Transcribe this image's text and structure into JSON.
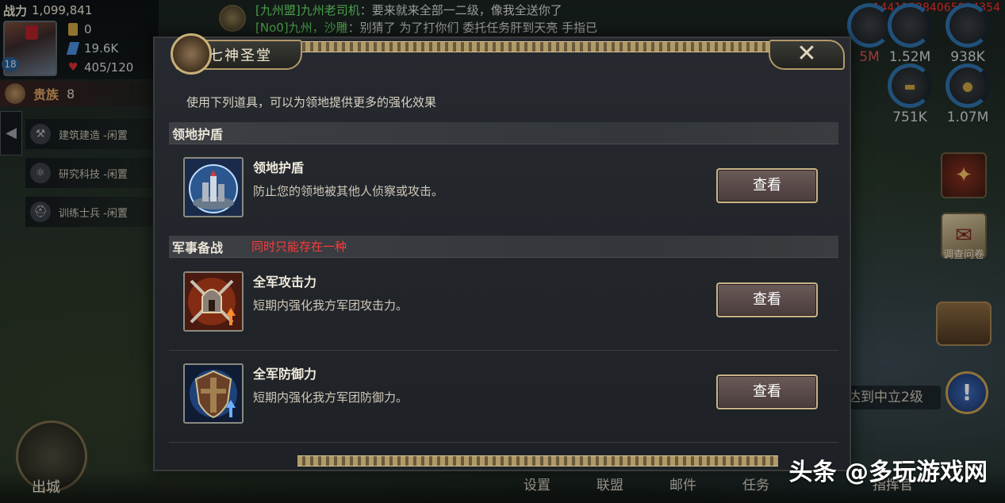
{
  "background": {
    "player": {
      "power_label": "战力",
      "power_value": "1,099,841",
      "level": "18",
      "stats": [
        "0",
        "19.6K",
        "405/120"
      ],
      "noble_label": "贵族",
      "noble_level": "8"
    },
    "queues": [
      "建筑建造 -闲置",
      "研究科技 -闲置",
      "训练士兵 -闲置"
    ],
    "side_toggle": "◀",
    "chat": [
      {
        "who": "[九州盟]九州老司机",
        "text": "：要来就来全部一二级，像我全送你了"
      },
      {
        "who": "[No0]九州，沙雕",
        "text": "：别猜了 为了打你们 委托任务肝到天亮 手指已"
      }
    ],
    "uid": "1441152840659943​54",
    "resources": [
      "5M",
      "1.52M",
      "938K",
      "751K",
      "1.07M"
    ],
    "survey_label": "调查问卷",
    "mission_text": "达到中立2级",
    "alert_glyph": "!",
    "bottom_nav": [
      "设置",
      "联盟",
      "邮件",
      "任务",
      "指挥官"
    ],
    "exit_label": "出城",
    "brand": "头条 @多玩游戏网"
  },
  "dialog": {
    "title": "七神圣堂",
    "close_glyph": "✕",
    "intro": "使用下列道具，可以为领地提供更多的强化效果",
    "sections": [
      {
        "title": "领地护盾",
        "warning": ""
      },
      {
        "title": "军事备战",
        "warning": "同时只能存在一种"
      }
    ],
    "items": [
      {
        "name": "领地护盾",
        "desc": "防止您的领地被其他人侦察或攻击。",
        "button": "查看",
        "icon": "shield-city-icon"
      },
      {
        "name": "全军攻击力",
        "desc": "短期内强化我方军团攻击力。",
        "button": "查看",
        "icon": "attack-helmet-icon"
      },
      {
        "name": "全军防御力",
        "desc": "短期内强化我方军团防御力。",
        "button": "查看",
        "icon": "defense-shield-icon"
      }
    ]
  },
  "colors": {
    "accent_gold": "#b09a68",
    "warning_red": "#ff3a3a",
    "chat_name_green": "#6adc6a"
  }
}
